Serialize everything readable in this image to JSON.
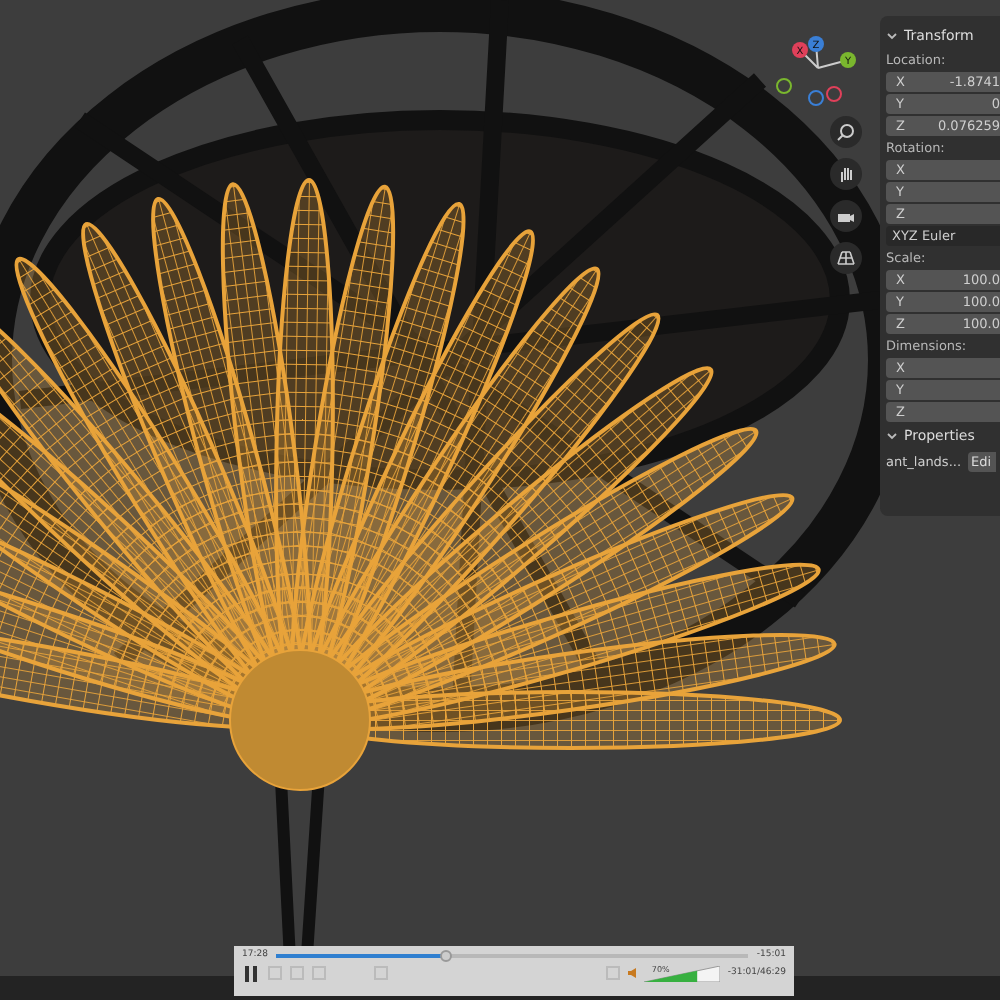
{
  "gizmo": {
    "axes": [
      {
        "label": "X",
        "color": "#e0405a"
      },
      {
        "label": "Z",
        "color": "#3a7fd6"
      },
      {
        "label": "Y",
        "color": "#7ab72e"
      }
    ]
  },
  "panel": {
    "sections": [
      {
        "kind": "header",
        "label": "Transform",
        "expanded": true
      },
      {
        "kind": "label",
        "label": "Location:"
      },
      {
        "kind": "field",
        "label": "X",
        "value": "-1.8741"
      },
      {
        "kind": "field",
        "label": "Y",
        "value": "0"
      },
      {
        "kind": "field",
        "label": "Z",
        "value": "0.076259"
      },
      {
        "kind": "label",
        "label": "Rotation:"
      },
      {
        "kind": "field",
        "label": "X"
      },
      {
        "kind": "field",
        "label": "Y"
      },
      {
        "kind": "field",
        "label": "Z"
      },
      {
        "kind": "dropdown",
        "label": "XYZ Euler"
      },
      {
        "kind": "label",
        "label": "Scale:"
      },
      {
        "kind": "field",
        "label": "X",
        "value": "100.0"
      },
      {
        "kind": "field",
        "label": "Y",
        "value": "100.0"
      },
      {
        "kind": "field",
        "label": "Z",
        "value": "100.0"
      },
      {
        "kind": "label",
        "label": "Dimensions:"
      },
      {
        "kind": "field",
        "label": "X"
      },
      {
        "kind": "field",
        "label": "Y"
      },
      {
        "kind": "field",
        "label": "Z"
      },
      {
        "kind": "header",
        "label": "Properties",
        "expanded": true
      },
      {
        "kind": "property",
        "label": "ant_lands...",
        "button": "Edi"
      }
    ]
  },
  "player": {
    "elapsed": "17:28",
    "remaining": "-15:01",
    "level": 0.36,
    "playing": true,
    "volume": {
      "text": "70%",
      "level": 0.7
    },
    "time_readout": "-31:01/46:29"
  }
}
